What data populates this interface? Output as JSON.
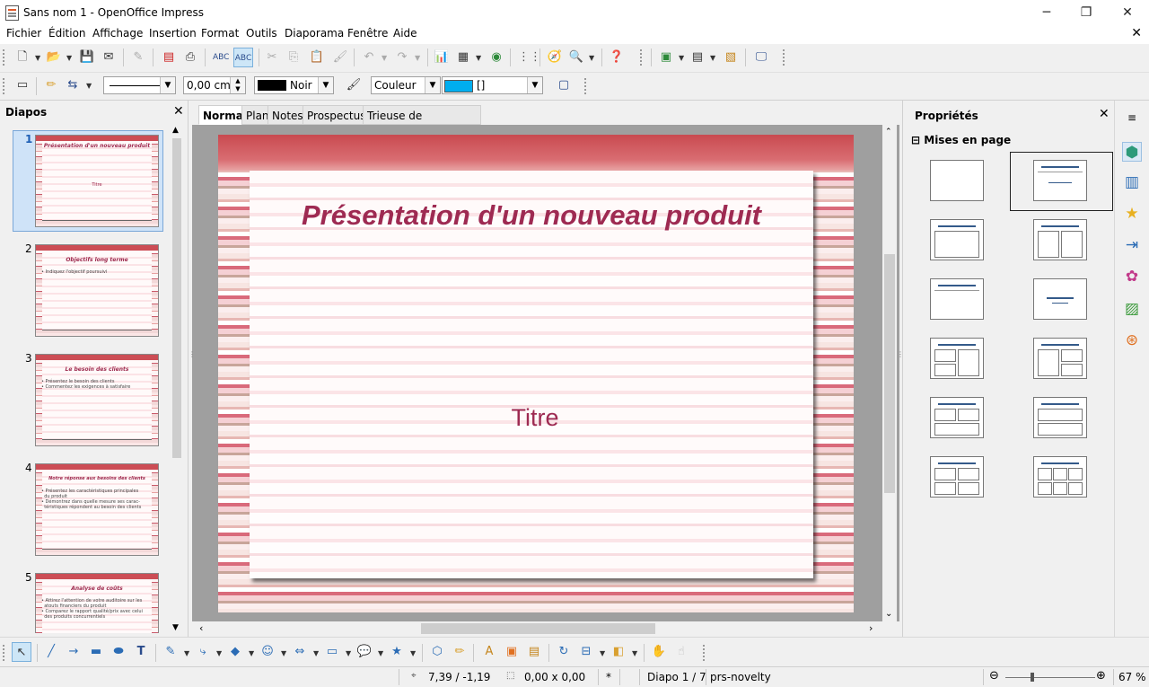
{
  "window": {
    "title": "Sans nom 1 - OpenOffice Impress",
    "minimize": "─",
    "restore": "❐",
    "close": "✕"
  },
  "menu": {
    "items": [
      "Fichier",
      "Édition",
      "Affichage",
      "Insertion",
      "Format",
      "Outils",
      "Diaporama",
      "Fenêtre",
      "Aide"
    ],
    "close": "✕"
  },
  "line_toolbar": {
    "width_value": "0,00 cm",
    "line_color": "Noir",
    "line_color_hex": "#000000",
    "area_style": "Couleur",
    "area_color_name": "[]",
    "area_color_hex": "#00aeef"
  },
  "slides_pane": {
    "title": "Diapos",
    "close": "✕",
    "thumbnails": [
      {
        "number": "1",
        "title": "Présentation d'un nouveau produit",
        "subtitle": "Titre",
        "bullets": []
      },
      {
        "number": "2",
        "title": "Objectifs long terme",
        "subtitle": "",
        "bullets": [
          "Indiquez l'objectif poursuivi"
        ]
      },
      {
        "number": "3",
        "title": "Le besoin des clients",
        "subtitle": "",
        "bullets": [
          "Présentez le besoin des clients",
          "Commentez les exigences à satisfaire"
        ]
      },
      {
        "number": "4",
        "title": "Notre réponse aux besoins des clients",
        "subtitle": "",
        "bullets": [
          "Présentez les caractéristiques principales",
          "du produit",
          "Démontrez dans quelle mesure ses carac-",
          "téristiques répondent au besoin des clients"
        ]
      },
      {
        "number": "5",
        "title": "Analyse de coûts",
        "subtitle": "",
        "bullets": [
          "Attirez l'attention de votre auditoire sur les",
          "atouts financiers du produit",
          "Comparez le rapport qualité/prix avec celui",
          "des produits concurrentiels"
        ]
      }
    ]
  },
  "view_tabs": [
    "Normal",
    "Plan",
    "Notes",
    "Prospectus",
    "Trieuse de diapositives"
  ],
  "active_tab": "Normal",
  "slide": {
    "title": "Présentation d'un nouveau produit",
    "subtitle": "Titre",
    "title_color": "#9e2a52"
  },
  "properties": {
    "title": "Propriétés",
    "close": "✕",
    "layouts_header": "Mises en page",
    "layouts_collapse": "⊟",
    "layouts": [
      "Diapo vierge",
      "Titre, contenu",
      "Titre et contenu",
      "Titre et 2 contenus",
      "Titre seulement",
      "Texte centré",
      "Titre, 2 contenus et contenu",
      "Titre, contenu et 2 contenus",
      "Titre, 2 contenus sur contenu",
      "Titre, contenu sur contenu",
      "Titre, 4 contenus",
      "Titre, 6 contenus"
    ],
    "selected_layout": "Titre, contenu"
  },
  "deck": {
    "menu": "≡",
    "icons": [
      "properties-icon",
      "master-pages-icon",
      "custom-animation-icon",
      "slide-transition-icon",
      "gallery-icon",
      "styles-icon",
      "navigator-icon"
    ]
  },
  "status": {
    "position": "7,39 / -1,19",
    "size": "0,00 x 0,00",
    "modified": "*",
    "slide": "Diapo 1 / 7",
    "master": "prs-novelty",
    "zoom": "67 %",
    "zoom_minus": "⊖",
    "zoom_plus": "⊕"
  }
}
